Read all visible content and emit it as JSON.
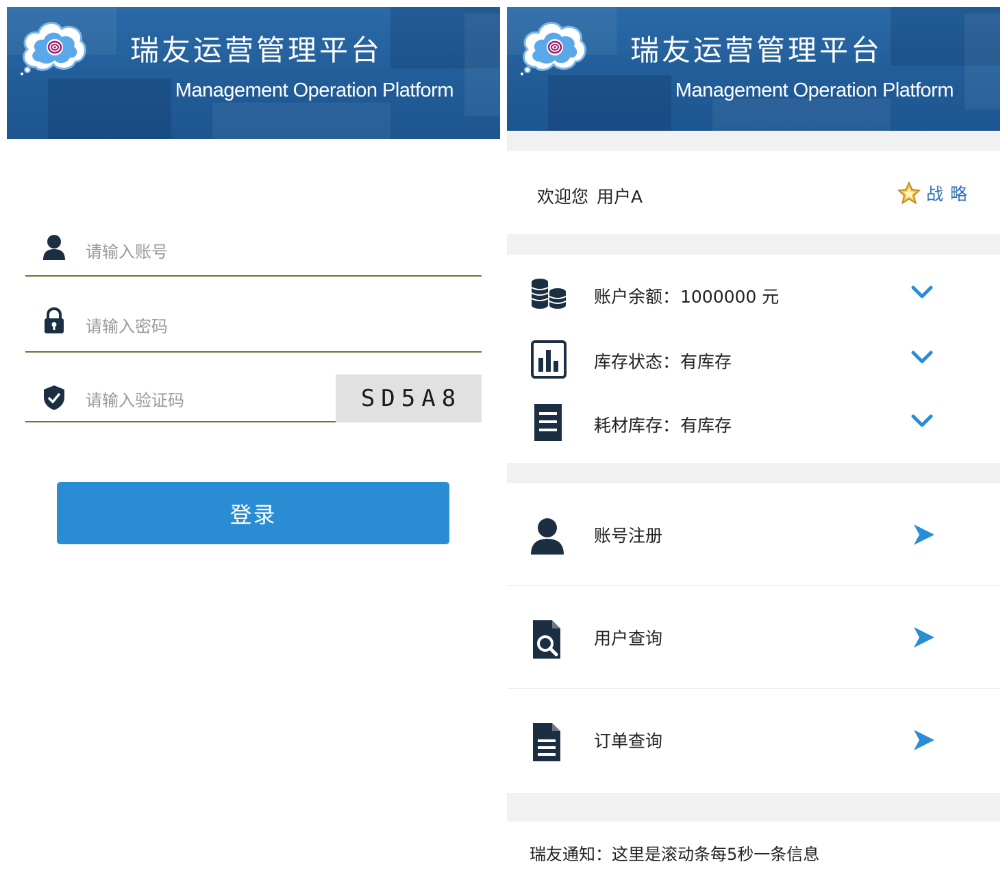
{
  "app": {
    "title": "瑞友运营管理平台",
    "subtitle": "Management Operation Platform"
  },
  "colors": {
    "banner": "#2262a0",
    "accent_blue": "#2a8dd4",
    "icon_dark": "#1c2e42",
    "field_underline": "#6b7335",
    "section_gray": "#f1f1f1"
  },
  "login": {
    "account_placeholder": "请输入账号",
    "password_placeholder": "请输入密码",
    "captcha_placeholder": "请输入验证码",
    "captcha_code": "SD5A8",
    "login_button": "登录",
    "icons": [
      "user-icon",
      "lock-icon",
      "shield-check-icon"
    ]
  },
  "dashboard": {
    "welcome_prefix": "欢迎您",
    "username": "用户A",
    "strategy_label": "战略",
    "status_rows": [
      {
        "label": "账户余额：",
        "value": "1000000 元",
        "icon": "coins-icon"
      },
      {
        "label": "库存状态：",
        "value": "有库存",
        "icon": "bar-chart-icon"
      },
      {
        "label": "耗材库存：",
        "value": "有库存",
        "icon": "list-document-icon"
      }
    ],
    "menu_items": [
      {
        "label": "账号注册",
        "icon": "user-icon"
      },
      {
        "label": "用户查询",
        "icon": "document-search-icon"
      },
      {
        "label": "订单查询",
        "icon": "document-icon"
      }
    ],
    "notice": "瑞友通知：这里是滚动条每5秒一条信息"
  }
}
